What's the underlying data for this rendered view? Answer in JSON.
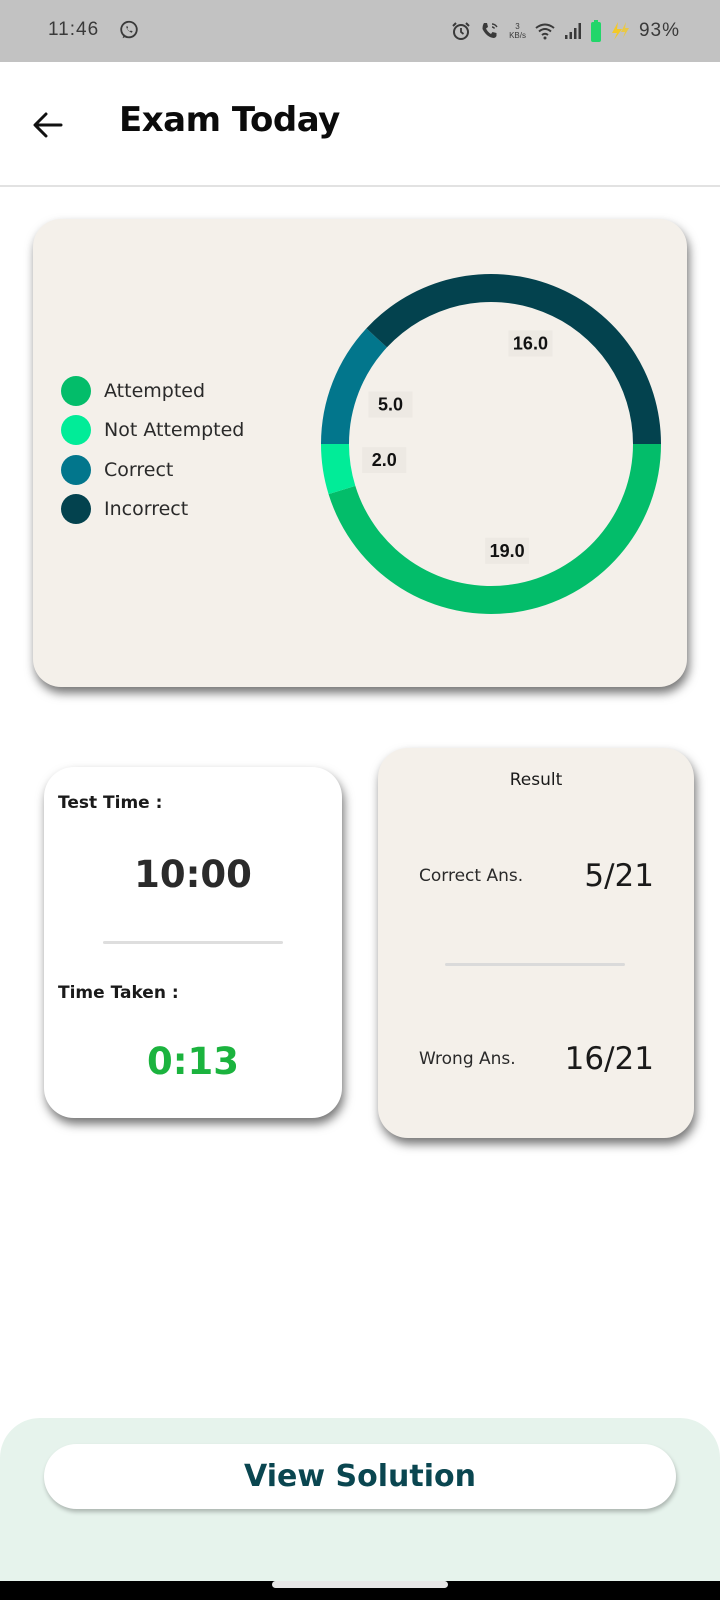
{
  "status_bar": {
    "time": "11:46",
    "network_speed_value": "3",
    "network_speed_unit": "KB/s",
    "battery_percent": "93%",
    "icons": [
      "whatsapp-icon",
      "alarm-icon",
      "wifi-call-icon",
      "wifi-icon",
      "signal-icon",
      "battery-icon",
      "charging-icon"
    ],
    "battery_color": "#22d66a",
    "charging_color": "#f3c927"
  },
  "app_bar": {
    "back_icon": "arrow-left-icon",
    "title": "Exam Today"
  },
  "chart_card": {
    "legend": [
      {
        "label": "Attempted",
        "color": "#03bd6a"
      },
      {
        "label": "Not Attempted",
        "color": "#01ec98"
      },
      {
        "label": "Correct",
        "color": "#02768c"
      },
      {
        "label": "Incorrect",
        "color": "#03424e"
      }
    ]
  },
  "chart_data": {
    "type": "pie",
    "variant": "donut",
    "title": "",
    "start_angle": "3 o'clock, clockwise",
    "categories": [
      "Attempted",
      "Not Attempted",
      "Correct",
      "Incorrect"
    ],
    "values": [
      19.0,
      2.0,
      5.0,
      16.0
    ],
    "labels": [
      "19.0",
      "2.0",
      "5.0",
      "16.0"
    ],
    "colors": [
      "#03bd6a",
      "#01ec98",
      "#02768c",
      "#03424e"
    ],
    "legend_position": "left"
  },
  "time_card": {
    "test_time_label": "Test Time :",
    "test_time_value": "10:00",
    "time_taken_label": "Time Taken :",
    "time_taken_value": "0:13",
    "time_taken_color": "#1bb33e"
  },
  "result_card": {
    "title": "Result",
    "correct_label": "Correct Ans.",
    "correct_value": "5/21",
    "wrong_label": "Wrong Ans.",
    "wrong_value": "16/21"
  },
  "footer": {
    "view_solution_label": "View Solution",
    "accent_color": "#0a4650"
  }
}
